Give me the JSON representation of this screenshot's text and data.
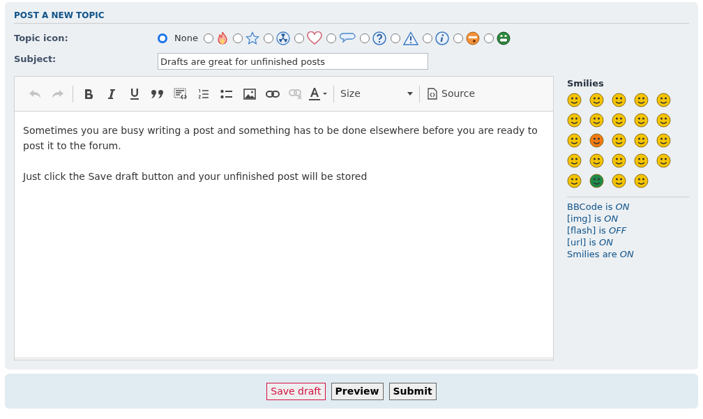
{
  "panel_title": "POST A NEW TOPIC",
  "topic_icon": {
    "label": "Topic icon:",
    "options": [
      {
        "kind": "none",
        "label": "None",
        "selected": true
      },
      {
        "kind": "fire",
        "selected": false
      },
      {
        "kind": "star",
        "selected": false
      },
      {
        "kind": "radioactive",
        "selected": false
      },
      {
        "kind": "heart",
        "selected": false
      },
      {
        "kind": "speech",
        "selected": false
      },
      {
        "kind": "question",
        "selected": false
      },
      {
        "kind": "warning",
        "selected": false
      },
      {
        "kind": "info",
        "selected": false
      },
      {
        "kind": "orange-face",
        "selected": false
      },
      {
        "kind": "green-face",
        "selected": false
      }
    ]
  },
  "subject": {
    "label": "Subject:",
    "value": "Drafts are great for unfinished posts"
  },
  "toolbar": [
    {
      "kind": "undo",
      "disabled": true
    },
    {
      "kind": "redo",
      "disabled": true
    },
    {
      "kind": "sep"
    },
    {
      "kind": "bold",
      "disabled": false
    },
    {
      "kind": "italic",
      "disabled": false
    },
    {
      "kind": "underline",
      "disabled": false
    },
    {
      "kind": "quote",
      "disabled": false
    },
    {
      "kind": "code",
      "disabled": false
    },
    {
      "kind": "olist",
      "disabled": false
    },
    {
      "kind": "ulist",
      "disabled": false
    },
    {
      "kind": "image",
      "disabled": false
    },
    {
      "kind": "link",
      "disabled": false
    },
    {
      "kind": "unlink",
      "disabled": true
    },
    {
      "kind": "color",
      "disabled": false
    },
    {
      "kind": "sep"
    },
    {
      "kind": "size",
      "label": "Size"
    },
    {
      "kind": "sep"
    },
    {
      "kind": "source",
      "label": "Source"
    }
  ],
  "message": [
    "Sometimes you are busy writing a post and something has to be done elsewhere before you are ready to post it to the forum.",
    "Just click the Save draft button and your unfinished post will be stored"
  ],
  "smilies": {
    "title": "Smilies",
    "items": [
      {
        "color": "#f5c400"
      },
      {
        "color": "#f5c400"
      },
      {
        "color": "#f5c400"
      },
      {
        "color": "#f5c400"
      },
      {
        "color": "#f5c400"
      },
      {
        "color": "#f5c400"
      },
      {
        "color": "#f5c400"
      },
      {
        "color": "#f5c400"
      },
      {
        "color": "#f5c400"
      },
      {
        "color": "#f5c400"
      },
      {
        "color": "#f5c400"
      },
      {
        "color": "#f27a12"
      },
      {
        "color": "#f5c400"
      },
      {
        "color": "#f5c400"
      },
      {
        "color": "#f5c400"
      },
      {
        "color": "#f5c400"
      },
      {
        "color": "#f5c400"
      },
      {
        "color": "#f5c400"
      },
      {
        "color": "#f5c400"
      },
      {
        "color": "#f5c400"
      },
      {
        "color": "#f5c400"
      },
      {
        "color": "#1e8a4a"
      },
      {
        "color": "#f5c400"
      },
      {
        "color": "#f5c400"
      }
    ]
  },
  "status": [
    "BBCode is *ON*",
    "[img] is *ON*",
    "[flash] is *OFF*",
    "[url] is *ON*",
    "Smilies are *ON*"
  ],
  "buttons": [
    {
      "kind": "draft",
      "label": "Save draft"
    },
    {
      "kind": "plain",
      "label": "Preview"
    },
    {
      "kind": "plain",
      "label": "Submit"
    }
  ]
}
